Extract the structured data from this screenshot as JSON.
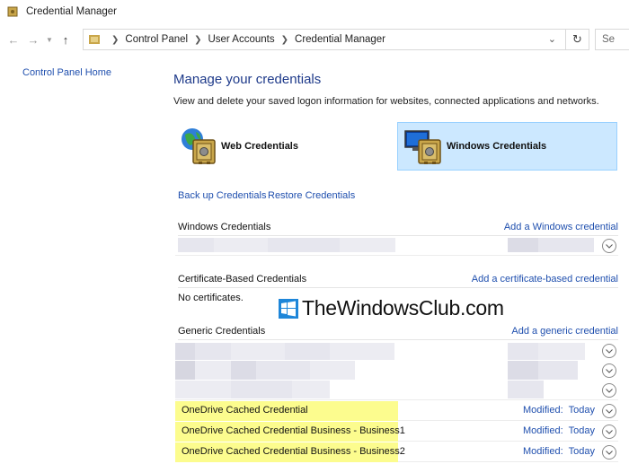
{
  "window": {
    "title": "Credential Manager"
  },
  "nav": {
    "breadcrumb": [
      "Control Panel",
      "User Accounts",
      "Credential Manager"
    ],
    "search_placeholder": "Se"
  },
  "sidebar": {
    "home_link": "Control Panel Home"
  },
  "main": {
    "title": "Manage your credentials",
    "description": "View and delete your saved logon information for websites, connected applications and networks.",
    "web_credentials": "Web Credentials",
    "windows_credentials": "Windows Credentials",
    "backup": "Back up Credentials",
    "restore": "Restore Credentials"
  },
  "sections": {
    "windows": {
      "header": "Windows Credentials",
      "add": "Add a Windows credential"
    },
    "certificate": {
      "header": "Certificate-Based Credentials",
      "add": "Add a certificate-based credential",
      "empty": "No certificates."
    },
    "generic": {
      "header": "Generic Credentials",
      "add": "Add a generic credential"
    }
  },
  "onedrive_rows": [
    {
      "name": "OneDrive Cached Credential",
      "modified_label": "Modified:",
      "modified_value": "Today"
    },
    {
      "name": "OneDrive Cached Credential Business - Business1",
      "modified_label": "Modified:",
      "modified_value": "Today"
    },
    {
      "name": "OneDrive Cached Credential Business - Business2",
      "modified_label": "Modified:",
      "modified_value": "Today"
    }
  ],
  "watermark": {
    "text": "TheWindowsClub.com"
  },
  "colors": {
    "selected_tile": "#cce8ff",
    "highlight": "#fcfc8e",
    "link": "#1f4fae",
    "title": "#1e3a8a"
  }
}
